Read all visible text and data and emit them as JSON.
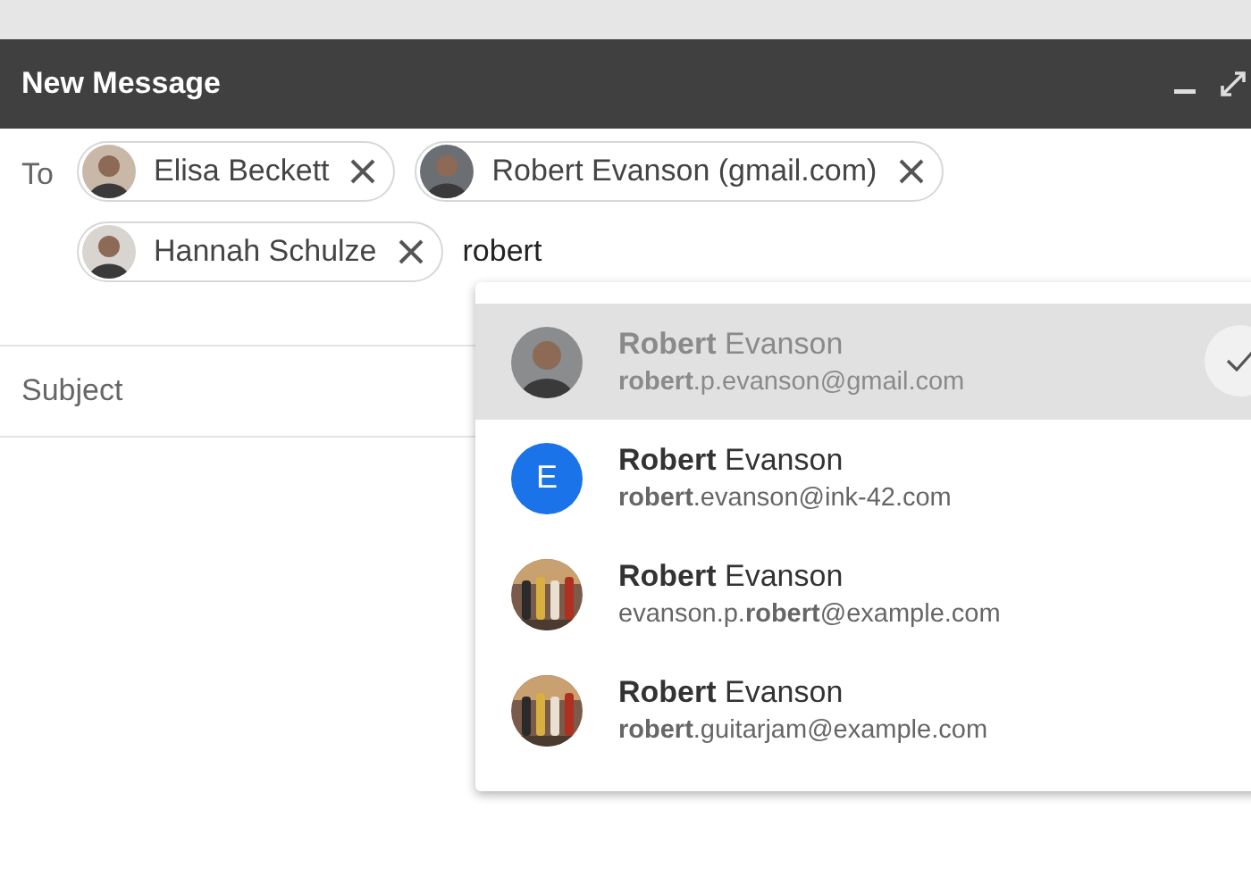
{
  "window": {
    "title": "New Message"
  },
  "to": {
    "label": "To",
    "recipients": [
      {
        "name": "Elisa Beckett",
        "avatar": {
          "kind": "person",
          "color": "#c9b8a8"
        }
      },
      {
        "name": "Robert Evanson (gmail.com)",
        "avatar": {
          "kind": "person",
          "color": "#6b6f74"
        }
      },
      {
        "name": "Hannah Schulze",
        "avatar": {
          "kind": "person",
          "color": "#d8d4d0"
        }
      }
    ],
    "value": "robert"
  },
  "subject": {
    "placeholder": "Subject"
  },
  "suggestions": [
    {
      "name": "**Robert** Evanson",
      "email": "**robert**.p.evanson@gmail.com",
      "avatar": {
        "kind": "person",
        "color": "#8a8c8e"
      },
      "selected": true
    },
    {
      "name": "**Robert** Evanson",
      "email": "**robert**.evanson@ink-42.com",
      "avatar": {
        "kind": "letter",
        "letter": "E",
        "color": "#1a73e8"
      },
      "selected": false
    },
    {
      "name": "**Robert** Evanson",
      "email": "evanson.p.**robert**@example.com",
      "selected": false
    },
    {
      "name": "**Robert** Evanson",
      "email": "**robert**.guitarjam@example.com",
      "selected": false
    }
  ]
}
